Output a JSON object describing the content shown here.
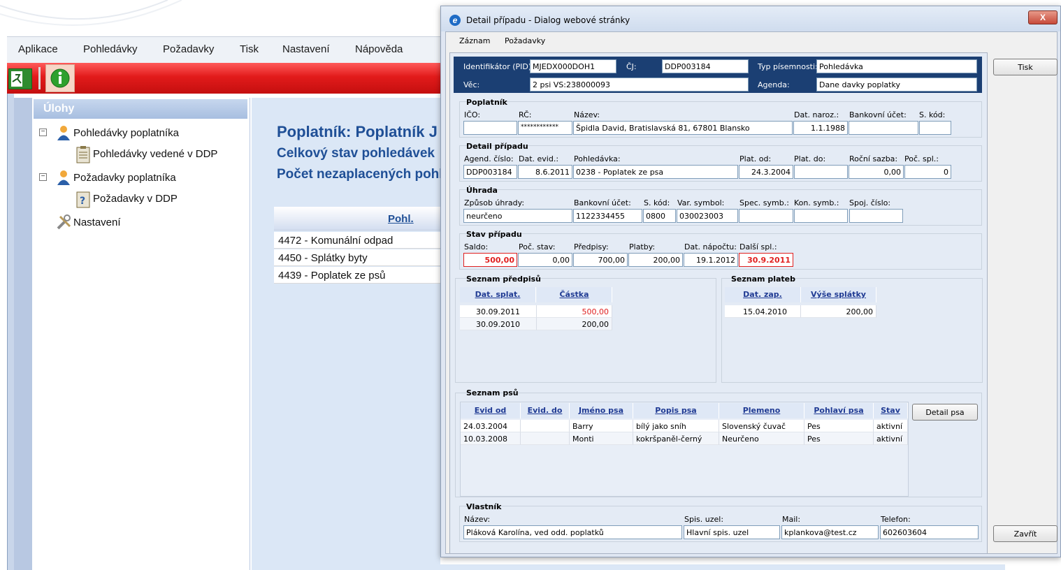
{
  "app": {
    "menu": [
      "Aplikace",
      "Pohledávky",
      "Požadavky",
      "Tisk",
      "Nastavení",
      "Nápověda"
    ],
    "sidebar_title": "Úlohy",
    "tree": [
      {
        "label": "Pohledávky poplatníka"
      },
      {
        "label": "Pohledávky vedené v DDP"
      },
      {
        "label": "Požadavky poplatníka"
      },
      {
        "label": "Požadavky v DDP"
      },
      {
        "label": "Nastavení"
      }
    ],
    "content": {
      "line1": "Poplatník: Poplatník J",
      "line2": "Celkový stav pohledávek",
      "line3": "Počet nezaplacených pohl",
      "table_header": "Pohl.",
      "rows": [
        "4472 - Komunální odpad",
        "4450 - Splátky byty",
        "4439 - Poplatek ze psů"
      ]
    },
    "colors": {
      "accent_red": "#e02020",
      "sidebar_header": "#a9bfe0",
      "content_bg": "#dbe7f6"
    }
  },
  "dialog": {
    "title": "Detail případu - Dialog webové stránky",
    "menu": [
      "Záznam",
      "Požadavky"
    ],
    "header": {
      "pid_label": "Identifikátor (PID):",
      "pid": "MJEDX000DOH1",
      "cj_label": "ČJ:",
      "cj": "DDP003184",
      "typ_label": "Typ písemnosti:",
      "typ": "Pohledávka",
      "vec_label": "Věc:",
      "vec": "2 psi VS:238000093",
      "agenda_label": "Agenda:",
      "agenda": "Dane davky poplatky"
    },
    "poplatnik": {
      "title": "Poplatník",
      "labels": {
        "ico": "IČO:",
        "rc": "RČ:",
        "nazev": "Název:",
        "dat_naroz": "Dat. naroz.:",
        "bank": "Bankovní účet:",
        "skod": "S. kód:"
      },
      "values": {
        "ico": "",
        "rc": "************",
        "nazev": "Špidla David, Bratislavská 81, 67801 Blansko",
        "dat_naroz": "1.1.1988",
        "bank": "",
        "skod": ""
      }
    },
    "detail": {
      "title": "Detail případu",
      "labels": {
        "agend": "Agend. číslo:",
        "dat_evid": "Dat. evid.:",
        "pohledavka": "Pohledávka:",
        "plat_od": "Plat. od:",
        "plat_do": "Plat. do:",
        "rocni": "Roční sazba:",
        "poc_spl": "Poč. spl.:"
      },
      "values": {
        "agend": "DDP003184",
        "dat_evid": "8.6.2011",
        "pohledavka": "0238 - Poplatek ze psa",
        "plat_od": "24.3.2004",
        "plat_do": "",
        "rocni": "0,00",
        "poc_spl": "0"
      }
    },
    "uhrada": {
      "title": "Úhrada",
      "labels": {
        "zpusob": "Způsob úhrady:",
        "bank": "Bankovní účet:",
        "skod": "S. kód:",
        "var": "Var. symbol:",
        "spec": "Spec. symb.:",
        "kon": "Kon. symb.:",
        "spoj": "Spoj. číslo:"
      },
      "values": {
        "zpusob": "neurčeno",
        "bank": "1122334455",
        "skod": "0800",
        "var": "030023003",
        "spec": "",
        "kon": "",
        "spoj": ""
      }
    },
    "stav": {
      "title": "Stav případu",
      "labels": {
        "saldo": "Saldo:",
        "poc_stav": "Poč. stav:",
        "predpisy": "Předpisy:",
        "platby": "Platby:",
        "dat_napoctu": "Dat. nápočtu:",
        "dalsi": "Další spl.:"
      },
      "values": {
        "saldo": "500,00",
        "poc_stav": "0,00",
        "predpisy": "700,00",
        "platby": "200,00",
        "dat_napoctu": "19.1.2012",
        "dalsi": "30.9.2011"
      }
    },
    "predpisy": {
      "title": "Seznam předpisů",
      "columns": [
        "Dat. splat.",
        "Částka"
      ],
      "rows": [
        [
          "30.09.2011",
          "500,00"
        ],
        [
          "30.09.2010",
          "200,00"
        ]
      ]
    },
    "platby": {
      "title": "Seznam plateb",
      "columns": [
        "Dat. zap.",
        "Výše splátky"
      ],
      "rows": [
        [
          "15.04.2010",
          "200,00"
        ]
      ]
    },
    "psi": {
      "title": "Seznam psů",
      "columns": [
        "Evid od",
        "Evid. do",
        "Jméno psa",
        "Popis psa",
        "Plemeno",
        "Pohlaví psa",
        "Stav"
      ],
      "rows": [
        [
          "24.03.2004",
          "",
          "Barry",
          "bílý jako sníh",
          "Slovenský čuvač",
          "Pes",
          "aktivní"
        ],
        [
          "10.03.2008",
          "",
          "Monti",
          "kokršpaněl-černý",
          "Neurčeno",
          "Pes",
          "aktivní"
        ]
      ],
      "detail_button": "Detail psa"
    },
    "vlastnik": {
      "title": "Vlastník",
      "labels": {
        "nazev": "Název:",
        "uzel": "Spis. uzel:",
        "mail": "Mail:",
        "tel": "Telefon:"
      },
      "values": {
        "nazev": "Pláková Karolína, ved odd. poplatků",
        "uzel": "Hlavní spis. uzel",
        "mail": "kplankova@test.cz",
        "tel": "602603604"
      }
    },
    "buttons": {
      "print": "Tisk",
      "close": "Zavřít",
      "window_close": "X"
    }
  }
}
